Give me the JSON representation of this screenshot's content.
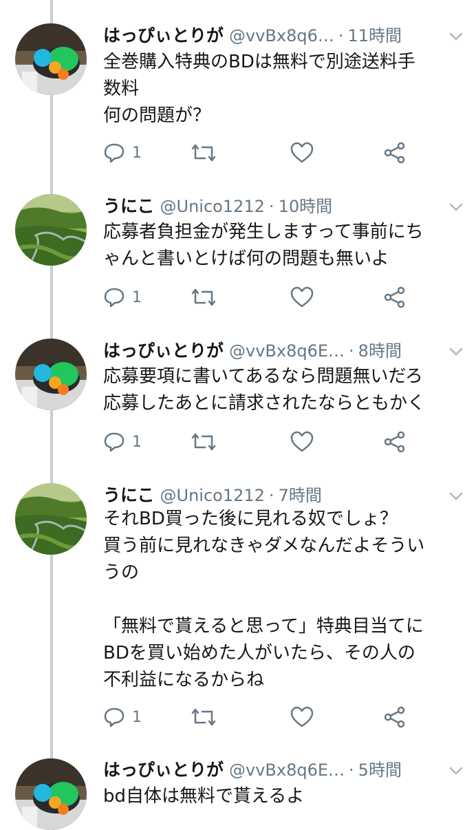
{
  "tweets": [
    {
      "name": "はっぴぃとりが",
      "handle": "@vvBx8q6…",
      "time": "11時間",
      "lines": [
        "全巻購入特典のBDは無料で別途送料手",
        "数料",
        "何の問題が？"
      ],
      "reply_count": "1",
      "avatar": "gear-toy"
    },
    {
      "name": "うにこ",
      "handle": "@Unico1212",
      "time": "10時間",
      "lines": [
        "応募者負担金が発生しますって事前にち",
        "ゃんと書いとけば何の問題も無いよ"
      ],
      "reply_count": "1",
      "avatar": "green-valley"
    },
    {
      "name": "はっぴぃとりが",
      "handle": "@vvBx8q6E…",
      "time": "8時間",
      "lines": [
        "応募要項に書いてあるなら問題無いだろ",
        "応募したあとに請求されたならともかく"
      ],
      "reply_count": "1",
      "avatar": "gear-toy"
    },
    {
      "name": "うにこ",
      "handle": "@Unico1212",
      "time": "7時間",
      "lines": [
        "それBD買った後に見れる奴でしょ？",
        "買う前に見れなきゃダメなんだよそうい",
        "うの",
        "",
        "「無料で貰えると思って」特典目当てに",
        "BDを買い始めた人がいたら、その人の",
        "不利益になるからね"
      ],
      "reply_count": "1",
      "avatar": "green-valley"
    },
    {
      "name": "はっぴぃとりが",
      "handle": "@vvBx8q6E…",
      "time": "5時間",
      "lines": [
        "bd自体は無料で貰えるよ"
      ],
      "reply_count": "",
      "avatar": "gear-toy"
    }
  ],
  "separator": "·",
  "colors": {
    "text": "#14171a",
    "secondary": "#657786",
    "thread_line": "#c4cfd6"
  }
}
